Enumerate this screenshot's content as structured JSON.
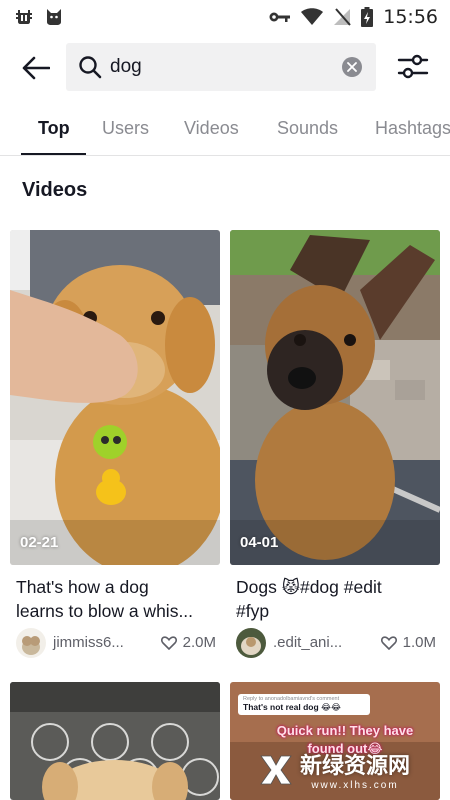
{
  "status_bar": {
    "time": "15:56"
  },
  "search": {
    "query": "dog"
  },
  "tabs": [
    {
      "label": "Top"
    },
    {
      "label": "Users"
    },
    {
      "label": "Videos"
    },
    {
      "label": "Sounds"
    },
    {
      "label": "Hashtags"
    }
  ],
  "section": {
    "title": "Videos"
  },
  "videos": [
    {
      "date": "02-21",
      "caption_line1": "That's how a dog",
      "caption_line2": "learns to blow a whis...",
      "username": "jimmiss6...",
      "likes": "2.0M"
    },
    {
      "date": "04-01",
      "caption_line1": "Dogs 😾#dog #edit",
      "caption_line2": "#fyp",
      "username": ".edit_ani...",
      "likes": "1.0M"
    },
    {
      "comment_reply": "Reply to anonadolbamiavnd's comment",
      "comment_text": "That's not real dog 😂😂",
      "overlay_line1": "Quick run!! They have",
      "overlay_line2": "found out😂"
    }
  ],
  "watermark": {
    "text": "新绿资源网",
    "url": "www.xlhs.com"
  },
  "colors": {
    "active_tab": "#161823",
    "inactive_tab": "#8a8b91",
    "search_bg": "#f1f1f2"
  }
}
